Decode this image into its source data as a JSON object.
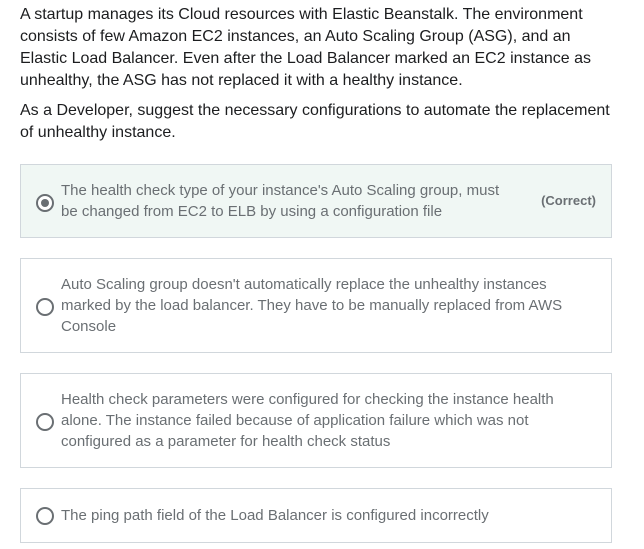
{
  "question": {
    "paragraph1": "A startup manages its Cloud resources with Elastic Beanstalk. The environment consists of few Amazon EC2 instances, an Auto Scaling Group (ASG), and an Elastic Load Balancer. Even after the Load Balancer marked an EC2 instance as unhealthy, the ASG has not replaced it with a healthy instance.",
    "paragraph2": "As a Developer, suggest the necessary configurations to automate the replacement of unhealthy instance."
  },
  "options": [
    {
      "text": "The health check type of your instance's Auto Scaling group, must be changed from EC2 to ELB by using a configuration file",
      "selected": true,
      "tag": "(Correct)"
    },
    {
      "text": "Auto Scaling group doesn't automatically replace the unhealthy instances marked by the load balancer. They have to be manually replaced from AWS Console",
      "selected": false
    },
    {
      "text": "Health check parameters were configured for checking the instance health alone. The instance failed because of application failure which was not configured as a parameter for health check status",
      "selected": false
    },
    {
      "text": "The ping path field of the Load Balancer is configured incorrectly",
      "selected": false
    }
  ],
  "colors": {
    "border": "#d1d7dc",
    "correct_bg": "#f0f7f4",
    "muted_text": "#6a6f73",
    "body_text": "#1c1d1f"
  }
}
